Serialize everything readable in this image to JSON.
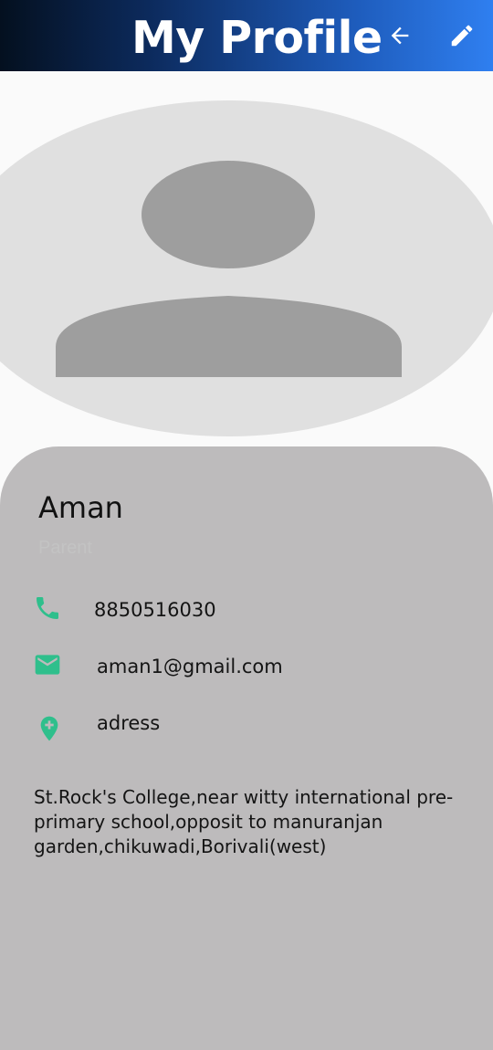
{
  "app_bar": {
    "title": "My Profile",
    "back_icon": "arrow-left-icon",
    "edit_icon": "pencil-icon",
    "gradient_colors": [
      "#04101f",
      "#0c2a5c",
      "#1e5cbc",
      "#2f7ff0"
    ]
  },
  "avatar": {
    "icon": "person-placeholder-icon",
    "background_color": "#e0e0e0",
    "silhouette_color": "#9e9e9e"
  },
  "profile": {
    "name": "Aman",
    "role": "Parent",
    "phone": "8850516030",
    "email": "aman1@gmail.com",
    "address_label": "adress",
    "address_full": "St.Rock's College,near witty international pre-primary school,opposit to manuranjan garden,chikuwadi,Borivali(west)"
  },
  "icons": {
    "phone": "phone-icon",
    "email": "email-icon",
    "address": "location-add-icon"
  },
  "colors": {
    "accent": "#2fbf8c",
    "card_background": "#bdbbbc",
    "page_background": "#fafafa"
  }
}
